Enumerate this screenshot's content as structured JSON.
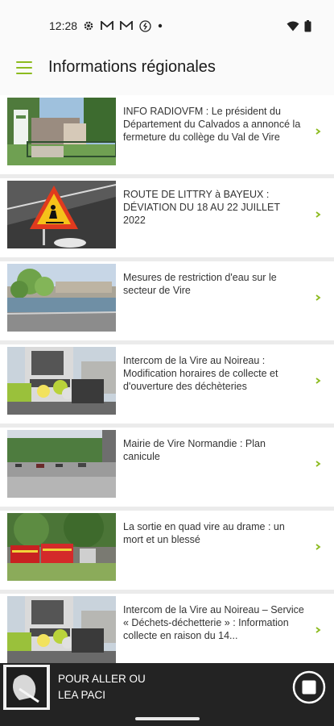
{
  "status_bar": {
    "time": "12:28",
    "icons": [
      "settings-gear-icon",
      "gmail-icon",
      "gmail-icon",
      "shazam-icon",
      "dot-icon",
      "wifi-icon",
      "battery-icon"
    ]
  },
  "app_bar": {
    "title": "Informations régionales",
    "menu_icon": "hamburger-menu-icon",
    "accent_color": "#8cbb1f"
  },
  "articles": [
    {
      "text": "INFO RADIOVFM : Le président du Département du Calvados a annoncé la fermeture du collège du Val de Vire",
      "thumb": "school-building"
    },
    {
      "text": "ROUTE DE LITTRY à BAYEUX : DÉVIATION DU 18 AU 22 JUILLET 2022",
      "thumb": "roadworks-sign"
    },
    {
      "text": "Mesures de restriction d'eau sur le secteur de Vire",
      "thumb": "river-lake"
    },
    {
      "text": "Intercom de la Vire au Noireau : Modification horaires de collecte et d'ouverture des déchèteries",
      "thumb": "garbage-truck"
    },
    {
      "text": "Mairie de Vire Normandie : Plan canicule",
      "thumb": "parking-lot"
    },
    {
      "text": "La sortie en quad vire au drame : un mort et un blessé",
      "thumb": "fire-trucks"
    },
    {
      "text": "Intercom de la Vire au Noireau – Service « Déchets-déchetterie » : Information collecte en raison du 14...",
      "thumb": "garbage-truck"
    }
  ],
  "player": {
    "title": "POUR ALLER OU",
    "artist": "LEA PACI",
    "control_icon": "stop-icon"
  }
}
